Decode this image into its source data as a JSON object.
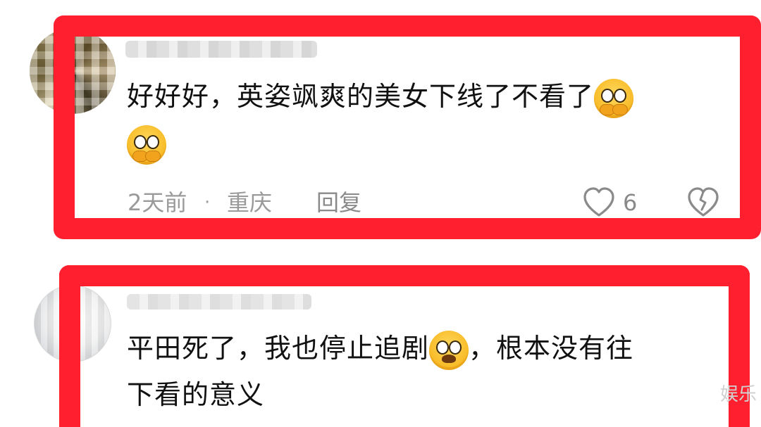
{
  "comments": [
    {
      "text": "好好好，英姿飒爽的美女下线了不看了",
      "emoji_names": [
        "pleading-face-hands-icon",
        "pleading-face-hands-icon"
      ],
      "meta": {
        "time": "2天前",
        "separator": "·",
        "location": "重庆",
        "reply": "回复",
        "likes": "6"
      }
    },
    {
      "text_part1": "平田死了，我也停止追剧",
      "text_part2": "，根本没有往",
      "text_part3": "下看的意义",
      "emoji_names": [
        "crying-face-icon"
      ]
    }
  ],
  "watermark": "娱乐",
  "colors": {
    "frame": "#ff1f2e",
    "meta_text": "#9a9a9a"
  }
}
